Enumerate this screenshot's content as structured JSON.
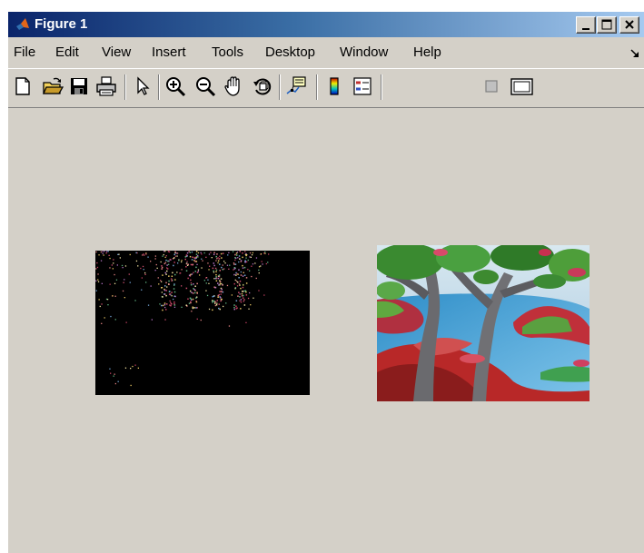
{
  "window": {
    "title": "Figure 1",
    "title_icon": "matlab-logo-icon",
    "controls": [
      "minimize-icon",
      "maximize-icon",
      "close-icon"
    ]
  },
  "menu": {
    "items": [
      {
        "label": "File"
      },
      {
        "label": "Edit"
      },
      {
        "label": "View"
      },
      {
        "label": "Insert"
      },
      {
        "label": "Tools"
      },
      {
        "label": "Desktop"
      },
      {
        "label": "Window"
      },
      {
        "label": "Help"
      }
    ]
  },
  "toolbar": {
    "tools": [
      {
        "name": "new-figure-icon"
      },
      {
        "name": "open-file-icon"
      },
      {
        "name": "save-icon"
      },
      {
        "name": "print-icon"
      },
      {
        "name": "edit-plot-arrow-icon"
      },
      {
        "name": "zoom-in-icon"
      },
      {
        "name": "zoom-out-icon"
      },
      {
        "name": "pan-hand-icon"
      },
      {
        "name": "rotate-3d-icon"
      },
      {
        "name": "data-cursor-icon"
      },
      {
        "name": "insert-colorbar-icon"
      },
      {
        "name": "insert-legend-icon"
      },
      {
        "name": "hide-plot-tools-icon"
      },
      {
        "name": "show-plot-tools-icon"
      }
    ]
  },
  "figure": {
    "background_color": "#d4d0c8",
    "images": [
      {
        "name": "filtered-image",
        "description_colors": [
          "#000000",
          "#c05070",
          "#e0c060"
        ]
      },
      {
        "name": "painting-image",
        "description_colors": [
          "#3a8fc8",
          "#c0302a",
          "#4a9a3a"
        ]
      }
    ]
  }
}
